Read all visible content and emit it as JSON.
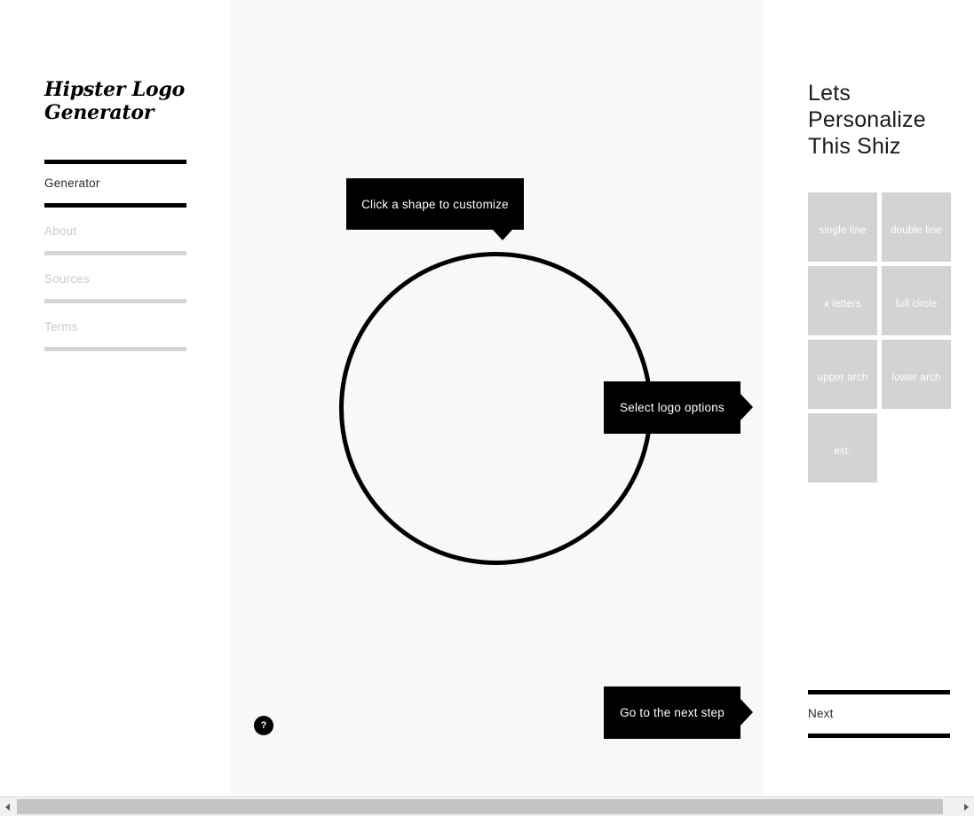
{
  "sidebar": {
    "brand": "Hipster Logo Generator",
    "items": [
      {
        "label": "Generator",
        "state": "active"
      },
      {
        "label": "About",
        "state": "dim"
      },
      {
        "label": "Sources",
        "state": "dim"
      },
      {
        "label": "Terms",
        "state": "dim"
      }
    ]
  },
  "canvas": {
    "shape": "circle",
    "callouts": {
      "customize": "Click a shape to customize",
      "options": "Select logo options",
      "next_step": "Go to the next step"
    },
    "help_label": "?"
  },
  "panel": {
    "heading": "Lets Personalize This Shiz",
    "options": [
      {
        "label": "single line"
      },
      {
        "label": "double line"
      },
      {
        "label": "x letters"
      },
      {
        "label": "full circle"
      },
      {
        "label": "upper arch"
      },
      {
        "label": "lower arch"
      },
      {
        "label": "est."
      }
    ],
    "next_label": "Next"
  },
  "scrollbar": {
    "left_arrow": "left-arrow-icon",
    "right_arrow": "right-arrow-icon"
  },
  "colors": {
    "accent": "#000000",
    "canvas_bg": "#f8f8f8",
    "tile_bg": "#d3d3d3",
    "dim_text": "#c9c9c9"
  }
}
